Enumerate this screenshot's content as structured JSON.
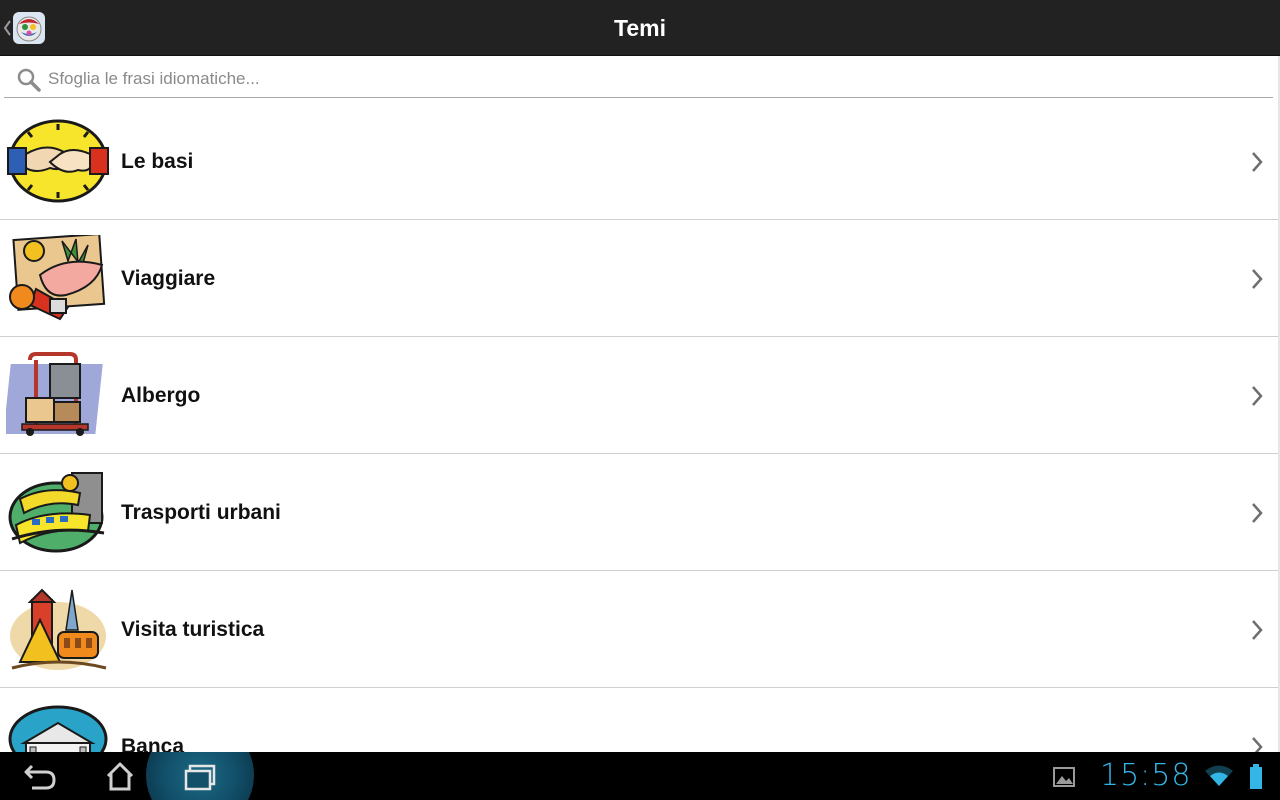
{
  "actionbar": {
    "title": "Temi",
    "back_icon": "back-chevron-icon",
    "app_icon": "app-logo-icon"
  },
  "search": {
    "placeholder": "Sfoglia le frasi idiomatiche...",
    "value": "",
    "icon": "search-icon"
  },
  "topics": [
    {
      "label": "Le basi",
      "icon": "handshake-icon"
    },
    {
      "label": "Viaggiare",
      "icon": "travel-icon"
    },
    {
      "label": "Albergo",
      "icon": "luggage-cart-icon"
    },
    {
      "label": "Trasporti urbani",
      "icon": "transport-icon"
    },
    {
      "label": "Visita turistica",
      "icon": "sightseeing-icon"
    },
    {
      "label": "Banca",
      "icon": "bank-icon"
    }
  ],
  "system_bar": {
    "time": "15:58",
    "buttons": [
      "back-icon",
      "home-icon",
      "recent-apps-icon"
    ],
    "status_icons": [
      "gallery-notification-icon",
      "wifi-icon",
      "battery-icon"
    ]
  },
  "colors": {
    "actionbar": "#222222",
    "accent": "#33b5e5",
    "divider": "#cfcfcf"
  }
}
